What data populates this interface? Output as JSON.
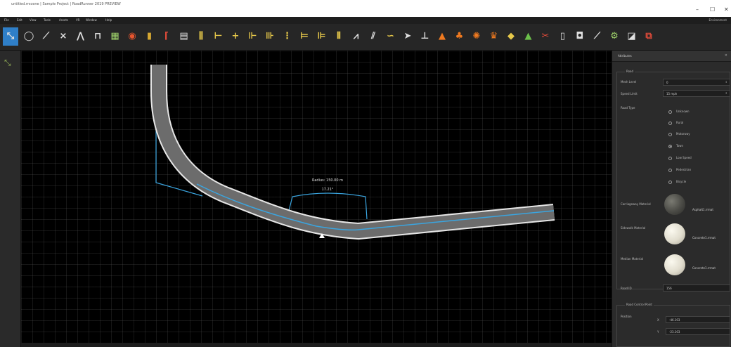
{
  "window": {
    "title": "untitled.rrscene | Sample Project | RoadRunner 2019 PREVIEW",
    "minimize": "–",
    "maximize": "☐",
    "close": "✕"
  },
  "menu": {
    "items": [
      "File",
      "Edit",
      "View",
      "Tools",
      "Assets",
      "VR",
      "Window",
      "Help"
    ],
    "right": "Environment"
  },
  "toolbar": {
    "tools": [
      {
        "name": "road-plan-tool-icon",
        "glyph": "⤡",
        "color": "#e0e0e0",
        "active": true
      },
      {
        "name": "circle-tool-icon",
        "glyph": "◯",
        "color": "#e0e0e0"
      },
      {
        "name": "road-tool-icon",
        "glyph": "⟋",
        "color": "#e0e0e0"
      },
      {
        "name": "junction-tool-icon",
        "glyph": "⨯",
        "color": "#e0e0e0"
      },
      {
        "name": "bridge-tool-icon",
        "glyph": "⋀",
        "color": "#e0e0e0"
      },
      {
        "name": "span-tool-icon",
        "glyph": "⊓",
        "color": "#e0e0e0"
      },
      {
        "name": "surface-tool-icon",
        "glyph": "▦",
        "color": "#9fd26b"
      },
      {
        "name": "marking-tool-icon",
        "glyph": "◉",
        "color": "#e8552e"
      },
      {
        "name": "signal-tool-icon",
        "glyph": "▮",
        "color": "#d6a832"
      },
      {
        "name": "sign-tool-icon",
        "glyph": "⌈",
        "color": "#e24b3a"
      },
      {
        "name": "prop-tool-icon",
        "glyph": "▤",
        "color": "#e0e0e0"
      },
      {
        "name": "lane-tool-icon",
        "glyph": "⫼",
        "color": "#e6c84a"
      },
      {
        "name": "lane-width-tool-icon",
        "glyph": "⊢",
        "color": "#e6c84a"
      },
      {
        "name": "lane-add-tool-icon",
        "glyph": "+",
        "color": "#e6c84a"
      },
      {
        "name": "lane-form-tool-icon",
        "glyph": "⊩",
        "color": "#e6c84a"
      },
      {
        "name": "lane-carve-tool-icon",
        "glyph": "⊪",
        "color": "#e6c84a"
      },
      {
        "name": "lane-marking-tool-icon",
        "glyph": "⋮",
        "color": "#e6c84a"
      },
      {
        "name": "lane-split-tool-icon",
        "glyph": "⊨",
        "color": "#e6c84a"
      },
      {
        "name": "lane-merge-tool-icon",
        "glyph": "⊫",
        "color": "#e6c84a"
      },
      {
        "name": "lane-attr-tool-icon",
        "glyph": "⫴",
        "color": "#e6c84a"
      },
      {
        "name": "corner-tool-icon",
        "glyph": "⩘",
        "color": "#e0e0e0"
      },
      {
        "name": "crosswalk-tool-icon",
        "glyph": "⫽",
        "color": "#e0e0e0"
      },
      {
        "name": "curve-tool-icon",
        "glyph": "∽",
        "color": "#e6c84a"
      },
      {
        "name": "arrow-tool-icon",
        "glyph": "➤",
        "color": "#e0e0e0"
      },
      {
        "name": "crossing-tool-icon",
        "glyph": "⊥",
        "color": "#e0e0e0"
      },
      {
        "name": "cone-tool-icon",
        "glyph": "▲",
        "color": "#f07a20"
      },
      {
        "name": "vegetation-tool-icon",
        "glyph": "♣",
        "color": "#f07a20"
      },
      {
        "name": "scatter-tool-icon",
        "glyph": "✺",
        "color": "#f07a20"
      },
      {
        "name": "fence-tool-icon",
        "glyph": "♛",
        "color": "#f07a20"
      },
      {
        "name": "warning-sign-tool-icon",
        "glyph": "◆",
        "color": "#e6c84a"
      },
      {
        "name": "terrain-tool-icon",
        "glyph": "▲",
        "color": "#6bbf4a"
      },
      {
        "name": "cut-tool-icon",
        "glyph": "✂",
        "color": "#e24b3a"
      },
      {
        "name": "measure-tool-icon",
        "glyph": "▯",
        "color": "#e0e0e0"
      },
      {
        "name": "camera-tool-icon",
        "glyph": "◘",
        "color": "#e0e0e0"
      },
      {
        "name": "elevation-tool-icon",
        "glyph": "⟋",
        "color": "#e0e0e0"
      },
      {
        "name": "world-settings-tool-icon",
        "glyph": "⚙",
        "color": "#9fd26b"
      },
      {
        "name": "layers-tool-icon",
        "glyph": "◪",
        "color": "#e0e0e0"
      },
      {
        "name": "export-tool-icon",
        "glyph": "⧉",
        "color": "#e24b3a"
      }
    ]
  },
  "viewport": {
    "radius_label": "Radius: 150.00 m",
    "angle_label": "17.21°"
  },
  "attributes": {
    "panel_title": "Attributes",
    "close": "×",
    "road_group": "Road",
    "mesh_level_label": "Mesh Level",
    "mesh_level_value": "0",
    "speed_limit_label": "Speed Limit",
    "speed_limit_value": "15 mph",
    "road_type_label": "Road Type",
    "road_types": [
      {
        "label": "Unknown",
        "selected": false
      },
      {
        "label": "Rural",
        "selected": false
      },
      {
        "label": "Motorway",
        "selected": false
      },
      {
        "label": "Town",
        "selected": true
      },
      {
        "label": "Low Speed",
        "selected": false
      },
      {
        "label": "Pedestrian",
        "selected": false
      },
      {
        "label": "Bicycle",
        "selected": false
      }
    ],
    "carriageway_label": "Carriageway Material",
    "carriageway_value": "Asphalt1.rrmat",
    "sidewalk_label": "Sidewalk Material",
    "sidewalk_value": "Concrete1.rrmat",
    "median_label": "Median Material",
    "median_value": "Concrete1.rrmat",
    "road_id_label": "Road ID",
    "road_id_value": "156",
    "control_group": "Road Control Point",
    "position_label": "Position",
    "pos_x_axis": "X",
    "pos_x_value": "-46.103",
    "pos_y_axis": "Y",
    "pos_y_value": "-23.103",
    "colors": {
      "asphalt": "#6c6c6c",
      "concrete": "#e6e2d6",
      "highlight": "#3aa5e0"
    }
  }
}
